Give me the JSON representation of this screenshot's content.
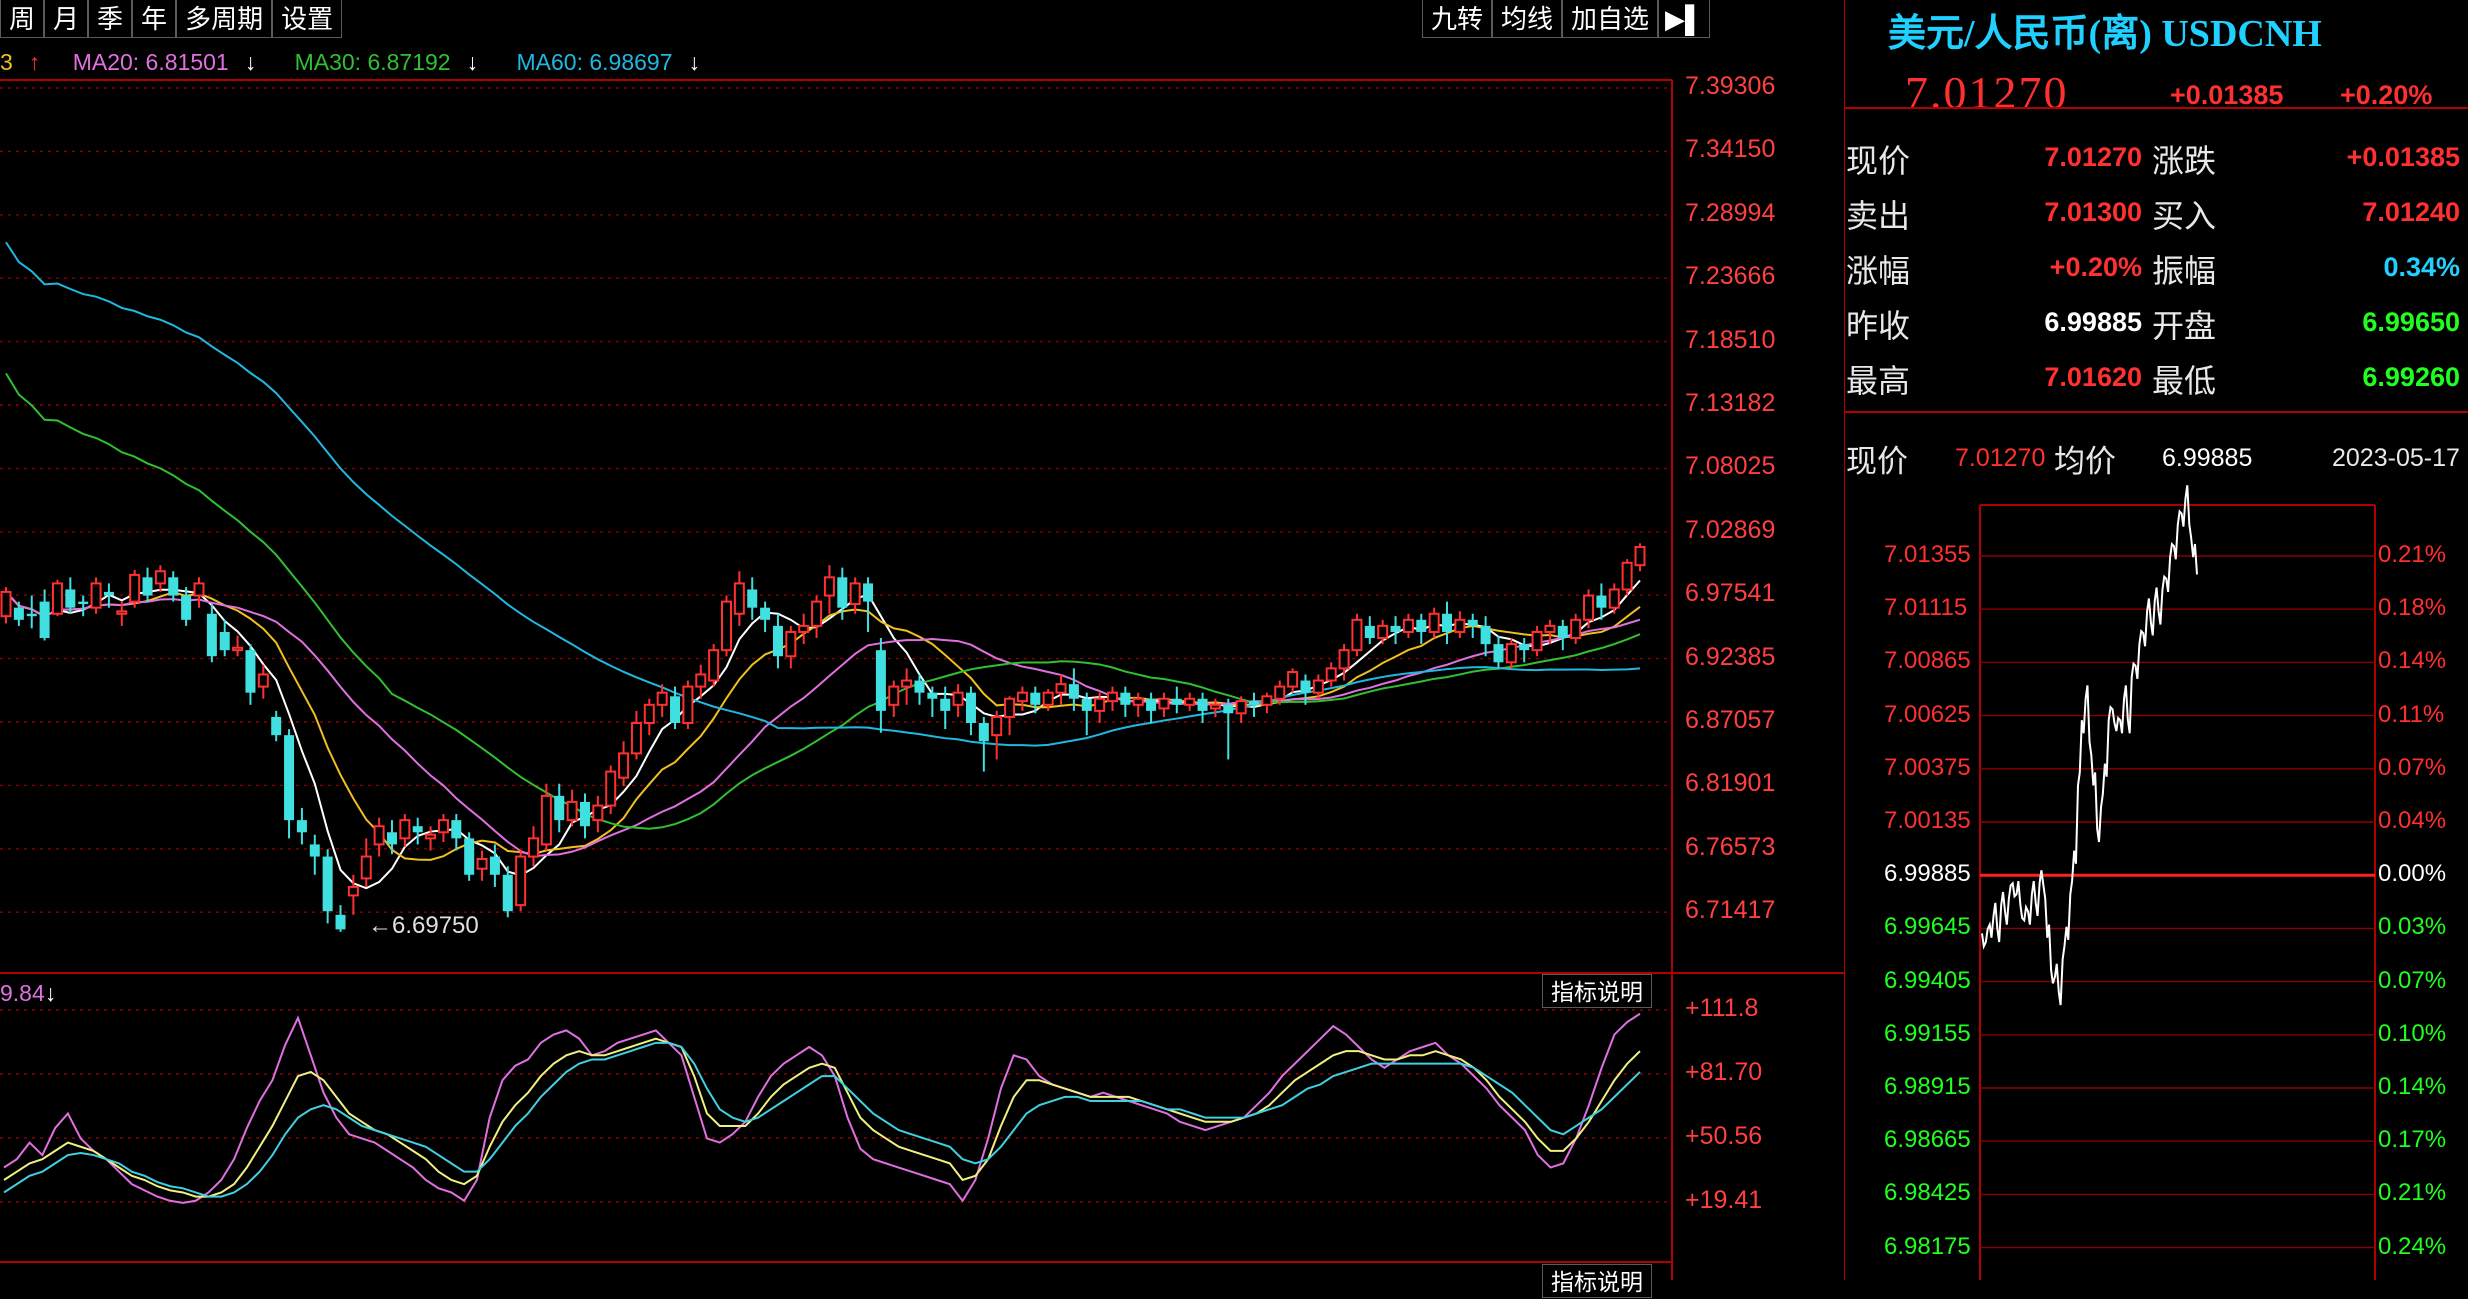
{
  "period_tabs": [
    "周",
    "月",
    "季",
    "年",
    "多周期",
    "设置"
  ],
  "right_tabs": [
    "九转",
    "均线",
    "加自选"
  ],
  "ma_legend": [
    {
      "prefix": "3",
      "arrow": "↑",
      "color": "#f0c020"
    },
    {
      "label": "MA20: 6.81501",
      "arrow": "↓",
      "color": "#e070e0"
    },
    {
      "label": "MA30: 6.87192",
      "arrow": "↓",
      "color": "#30c030"
    },
    {
      "label": "MA60: 6.98697",
      "arrow": "↓",
      "color": "#20b8e0"
    }
  ],
  "price_axis": [
    "7.39306",
    "7.34150",
    "7.28994",
    "7.23666",
    "7.18510",
    "7.13182",
    "7.08025",
    "7.02869",
    "6.97541",
    "6.92385",
    "6.87057",
    "6.81901",
    "6.76573",
    "6.71417"
  ],
  "low_marker": "←6.69750",
  "indicator": {
    "value_label": "9.84",
    "arrow": "↓",
    "button": "指标说明",
    "axis": [
      "+111.8",
      "+81.70",
      "+50.56",
      "+19.41"
    ],
    "bottom_button": "指标说明"
  },
  "quote": {
    "title": "美元/人民币(离) USDCNH",
    "price": "7.01270",
    "change": "+0.01385",
    "change_pct": "+0.20%",
    "rows": [
      {
        "l1": "现价",
        "v1": "7.01270",
        "c1": "#ff3030",
        "l2": "涨跌",
        "v2": "+0.01385",
        "c2": "#ff3030"
      },
      {
        "l1": "卖出",
        "v1": "7.01300",
        "c1": "#ff3030",
        "l2": "买入",
        "v2": "7.01240",
        "c2": "#ff3030"
      },
      {
        "l1": "涨幅",
        "v1": "+0.20%",
        "c1": "#ff3030",
        "l2": "振幅",
        "v2": "0.34%",
        "c2": "#20d0ff"
      },
      {
        "l1": "昨收",
        "v1": "6.99885",
        "c1": "#ffffff",
        "l2": "开盘",
        "v2": "6.99650",
        "c2": "#20ff20"
      },
      {
        "l1": "最高",
        "v1": "7.01620",
        "c1": "#ff3030",
        "l2": "最低",
        "v2": "6.99260",
        "c2": "#20ff20"
      }
    ]
  },
  "intraday": {
    "price_label": "现价",
    "price": "7.01270",
    "avg_label": "均价",
    "avg": "6.99885",
    "date": "2023-05-17",
    "left_axis": [
      "7.01355",
      "7.01115",
      "7.00865",
      "7.00625",
      "7.00375",
      "7.00135",
      "6.99885",
      "6.99645",
      "6.99405",
      "6.99155",
      "6.98915",
      "6.98665",
      "6.98425",
      "6.98175"
    ],
    "right_axis": [
      "0.21%",
      "0.18%",
      "0.14%",
      "0.11%",
      "0.07%",
      "0.04%",
      "0.00%",
      "0.03%",
      "0.07%",
      "0.10%",
      "0.14%",
      "0.17%",
      "0.21%",
      "0.24%"
    ]
  },
  "colors": {
    "up": "#ff3030",
    "down": "#40e0e0",
    "grid": "#8b0000",
    "frame": "#b00000"
  },
  "chart_data": {
    "type": "candlestick",
    "ylim": [
      6.69,
      7.4
    ],
    "candles": [
      [
        6.958,
        6.978,
        6.952,
        6.982
      ],
      [
        6.965,
        6.955,
        6.95,
        6.97
      ],
      [
        6.96,
        6.958,
        6.948,
        6.975
      ],
      [
        6.97,
        6.94,
        6.938,
        6.98
      ],
      [
        6.96,
        6.985,
        6.958,
        6.988
      ],
      [
        6.98,
        6.965,
        6.96,
        6.99
      ],
      [
        6.97,
        6.968,
        6.958,
        6.975
      ],
      [
        6.965,
        6.985,
        6.96,
        6.99
      ],
      [
        6.978,
        6.975,
        6.965,
        6.985
      ],
      [
        6.96,
        6.962,
        6.95,
        6.97
      ],
      [
        6.97,
        6.992,
        6.965,
        6.996
      ],
      [
        6.99,
        6.975,
        6.97,
        6.998
      ],
      [
        6.985,
        6.995,
        6.978,
        7.0
      ],
      [
        6.99,
        6.975,
        6.97,
        6.995
      ],
      [
        6.975,
        6.955,
        6.95,
        6.982
      ],
      [
        6.975,
        6.985,
        6.965,
        6.99
      ],
      [
        6.96,
        6.925,
        6.92,
        6.968
      ],
      [
        6.945,
        6.93,
        6.925,
        6.955
      ],
      [
        6.93,
        6.932,
        6.925,
        6.942
      ],
      [
        6.93,
        6.895,
        6.885,
        6.935
      ],
      [
        6.9,
        6.91,
        6.89,
        6.918
      ],
      [
        6.875,
        6.86,
        6.855,
        6.88
      ],
      [
        6.86,
        6.79,
        6.775,
        6.865
      ],
      [
        6.79,
        6.78,
        6.77,
        6.8
      ],
      [
        6.77,
        6.76,
        6.745,
        6.778
      ],
      [
        6.76,
        6.715,
        6.705,
        6.766
      ],
      [
        6.712,
        6.7,
        6.698,
        6.72
      ],
      [
        6.728,
        6.735,
        6.712,
        6.745
      ],
      [
        6.742,
        6.76,
        6.735,
        6.775
      ],
      [
        6.77,
        6.785,
        6.76,
        6.792
      ],
      [
        6.78,
        6.77,
        6.762,
        6.79
      ],
      [
        6.775,
        6.79,
        6.768,
        6.795
      ],
      [
        6.785,
        6.78,
        6.77,
        6.792
      ],
      [
        6.775,
        6.778,
        6.765,
        6.785
      ],
      [
        6.78,
        6.79,
        6.772,
        6.795
      ],
      [
        6.79,
        6.775,
        6.765,
        6.795
      ],
      [
        6.775,
        6.745,
        6.74,
        6.78
      ],
      [
        6.75,
        6.758,
        6.74,
        6.765
      ],
      [
        6.76,
        6.745,
        6.735,
        6.77
      ],
      [
        6.745,
        6.715,
        6.71,
        6.752
      ],
      [
        6.72,
        6.76,
        6.715,
        6.765
      ],
      [
        6.76,
        6.775,
        6.752,
        6.785
      ],
      [
        6.77,
        6.81,
        6.765,
        6.82
      ],
      [
        6.81,
        6.79,
        6.78,
        6.82
      ],
      [
        6.79,
        6.805,
        6.785,
        6.815
      ],
      [
        6.805,
        6.785,
        6.775,
        6.812
      ],
      [
        6.79,
        6.802,
        6.78,
        6.81
      ],
      [
        6.802,
        6.83,
        6.795,
        6.835
      ],
      [
        6.825,
        6.845,
        6.818,
        6.855
      ],
      [
        6.845,
        6.87,
        6.84,
        6.88
      ],
      [
        6.87,
        6.885,
        6.86,
        6.89
      ],
      [
        6.885,
        6.895,
        6.875,
        6.902
      ],
      [
        6.892,
        6.87,
        6.865,
        6.9
      ],
      [
        6.87,
        6.9,
        6.865,
        6.905
      ],
      [
        6.9,
        6.91,
        6.89,
        6.918
      ],
      [
        6.905,
        6.93,
        6.9,
        6.935
      ],
      [
        6.93,
        6.97,
        6.925,
        6.975
      ],
      [
        6.96,
        6.985,
        6.95,
        6.995
      ],
      [
        6.98,
        6.965,
        6.955,
        6.99
      ],
      [
        6.965,
        6.955,
        6.945,
        6.97
      ],
      [
        6.95,
        6.925,
        6.915,
        6.96
      ],
      [
        6.925,
        6.945,
        6.915,
        6.95
      ],
      [
        6.945,
        6.95,
        6.935,
        6.96
      ],
      [
        6.95,
        6.97,
        6.94,
        6.975
      ],
      [
        6.975,
        6.99,
        6.96,
        7.0
      ],
      [
        6.99,
        6.965,
        6.955,
        6.998
      ],
      [
        6.968,
        6.985,
        6.96,
        6.99
      ],
      [
        6.985,
        6.97,
        6.945,
        6.99
      ],
      [
        6.93,
        6.88,
        6.862,
        6.94
      ],
      [
        6.885,
        6.9,
        6.875,
        6.905
      ],
      [
        6.9,
        6.905,
        6.885,
        6.915
      ],
      [
        6.905,
        6.895,
        6.885,
        6.91
      ],
      [
        6.895,
        6.89,
        6.875,
        6.9
      ],
      [
        6.89,
        6.88,
        6.865,
        6.9
      ],
      [
        6.885,
        6.895,
        6.875,
        6.902
      ],
      [
        6.895,
        6.87,
        6.86,
        6.9
      ],
      [
        6.87,
        6.855,
        6.83,
        6.875
      ],
      [
        6.86,
        6.875,
        6.84,
        6.88
      ],
      [
        6.875,
        6.89,
        6.86,
        6.892
      ],
      [
        6.888,
        6.895,
        6.88,
        6.9
      ],
      [
        6.895,
        6.885,
        6.878,
        6.9
      ],
      [
        6.885,
        6.895,
        6.88,
        6.898
      ],
      [
        6.895,
        6.902,
        6.885,
        6.91
      ],
      [
        6.902,
        6.89,
        6.88,
        6.915
      ],
      [
        6.89,
        6.88,
        6.86,
        6.895
      ],
      [
        6.88,
        6.89,
        6.87,
        6.895
      ],
      [
        6.888,
        6.895,
        6.88,
        6.9
      ],
      [
        6.895,
        6.885,
        6.875,
        6.9
      ],
      [
        6.885,
        6.89,
        6.875,
        6.895
      ],
      [
        6.89,
        6.88,
        6.87,
        6.895
      ],
      [
        6.882,
        6.89,
        6.875,
        6.895
      ],
      [
        6.89,
        6.885,
        6.878,
        6.9
      ],
      [
        6.885,
        6.89,
        6.88,
        6.895
      ],
      [
        6.89,
        6.88,
        6.87,
        6.895
      ],
      [
        6.882,
        6.885,
        6.875,
        6.89
      ],
      [
        6.885,
        6.878,
        6.84,
        6.89
      ],
      [
        6.878,
        6.888,
        6.87,
        6.892
      ],
      [
        6.888,
        6.885,
        6.875,
        6.895
      ],
      [
        6.885,
        6.892,
        6.878,
        6.895
      ],
      [
        6.89,
        6.9,
        6.885,
        6.905
      ],
      [
        6.9,
        6.912,
        6.895,
        6.915
      ],
      [
        6.905,
        6.895,
        6.885,
        6.91
      ],
      [
        6.895,
        6.905,
        6.89,
        6.91
      ],
      [
        6.905,
        6.915,
        6.9,
        6.92
      ],
      [
        6.915,
        6.93,
        6.905,
        6.935
      ],
      [
        6.93,
        6.955,
        6.925,
        6.96
      ],
      [
        6.95,
        6.94,
        6.935,
        6.958
      ],
      [
        6.94,
        6.95,
        6.935,
        6.955
      ],
      [
        6.95,
        6.945,
        6.935,
        6.958
      ],
      [
        6.945,
        6.955,
        6.94,
        6.96
      ],
      [
        6.955,
        6.945,
        6.935,
        6.96
      ],
      [
        6.945,
        6.96,
        6.94,
        6.965
      ],
      [
        6.96,
        6.945,
        6.935,
        6.97
      ],
      [
        6.945,
        6.955,
        6.94,
        6.962
      ],
      [
        6.955,
        6.95,
        6.94,
        6.96
      ],
      [
        6.95,
        6.935,
        6.925,
        6.958
      ],
      [
        6.935,
        6.92,
        6.915,
        6.942
      ],
      [
        6.92,
        6.935,
        6.915,
        6.94
      ],
      [
        6.935,
        6.93,
        6.92,
        6.94
      ],
      [
        6.93,
        6.945,
        6.925,
        6.95
      ],
      [
        6.945,
        6.95,
        6.935,
        6.955
      ],
      [
        6.95,
        6.94,
        6.93,
        6.955
      ],
      [
        6.94,
        6.955,
        6.935,
        6.96
      ],
      [
        6.955,
        6.975,
        6.948,
        6.98
      ],
      [
        6.975,
        6.965,
        6.955,
        6.985
      ],
      [
        6.965,
        6.98,
        6.96,
        6.985
      ],
      [
        6.98,
        7.002,
        6.975,
        7.005
      ],
      [
        7.0,
        7.015,
        6.995,
        7.018
      ]
    ],
    "oscillator": [
      [
        36,
        30,
        24
      ],
      [
        40,
        34,
        28
      ],
      [
        48,
        38,
        32
      ],
      [
        42,
        40,
        34
      ],
      [
        55,
        44,
        38
      ],
      [
        62,
        48,
        42
      ],
      [
        50,
        46,
        43
      ],
      [
        44,
        44,
        42
      ],
      [
        40,
        40,
        40
      ],
      [
        34,
        36,
        38
      ],
      [
        28,
        32,
        34
      ],
      [
        25,
        30,
        32
      ],
      [
        22,
        27,
        29
      ],
      [
        20,
        25,
        27
      ],
      [
        19,
        24,
        26
      ],
      [
        20,
        22,
        24
      ],
      [
        24,
        22,
        22
      ],
      [
        30,
        24,
        22
      ],
      [
        40,
        28,
        24
      ],
      [
        55,
        36,
        28
      ],
      [
        68,
        46,
        34
      ],
      [
        78,
        56,
        42
      ],
      [
        95,
        68,
        52
      ],
      [
        108,
        80,
        60
      ],
      [
        90,
        82,
        64
      ],
      [
        72,
        78,
        66
      ],
      [
        60,
        70,
        64
      ],
      [
        52,
        62,
        60
      ],
      [
        50,
        58,
        56
      ],
      [
        48,
        54,
        54
      ],
      [
        44,
        52,
        52
      ],
      [
        40,
        48,
        50
      ],
      [
        36,
        44,
        48
      ],
      [
        30,
        40,
        46
      ],
      [
        26,
        34,
        42
      ],
      [
        24,
        30,
        38
      ],
      [
        20,
        28,
        34
      ],
      [
        30,
        32,
        34
      ],
      [
        60,
        46,
        40
      ],
      [
        78,
        58,
        48
      ],
      [
        85,
        66,
        56
      ],
      [
        88,
        72,
        62
      ],
      [
        96,
        80,
        70
      ],
      [
        100,
        86,
        76
      ],
      [
        102,
        90,
        82
      ],
      [
        98,
        92,
        86
      ],
      [
        90,
        90,
        88
      ],
      [
        92,
        90,
        88
      ],
      [
        96,
        92,
        90
      ],
      [
        98,
        94,
        92
      ],
      [
        100,
        96,
        94
      ],
      [
        102,
        98,
        96
      ],
      [
        96,
        96,
        96
      ],
      [
        90,
        94,
        94
      ],
      [
        70,
        80,
        86
      ],
      [
        50,
        62,
        74
      ],
      [
        48,
        56,
        64
      ],
      [
        52,
        56,
        60
      ],
      [
        58,
        56,
        58
      ],
      [
        70,
        62,
        60
      ],
      [
        80,
        70,
        64
      ],
      [
        86,
        76,
        68
      ],
      [
        90,
        80,
        72
      ],
      [
        94,
        84,
        76
      ],
      [
        90,
        86,
        80
      ],
      [
        80,
        84,
        80
      ],
      [
        60,
        72,
        74
      ],
      [
        45,
        60,
        68
      ],
      [
        40,
        54,
        62
      ],
      [
        38,
        50,
        58
      ],
      [
        36,
        46,
        54
      ],
      [
        34,
        44,
        52
      ],
      [
        32,
        42,
        50
      ],
      [
        30,
        40,
        48
      ],
      [
        28,
        38,
        46
      ],
      [
        20,
        30,
        40
      ],
      [
        30,
        32,
        38
      ],
      [
        50,
        40,
        40
      ],
      [
        74,
        56,
        46
      ],
      [
        90,
        70,
        54
      ],
      [
        88,
        78,
        62
      ],
      [
        80,
        78,
        66
      ],
      [
        76,
        76,
        68
      ],
      [
        74,
        74,
        70
      ],
      [
        72,
        72,
        70
      ],
      [
        70,
        70,
        68
      ],
      [
        72,
        70,
        68
      ],
      [
        70,
        70,
        68
      ],
      [
        68,
        70,
        68
      ],
      [
        66,
        68,
        68
      ],
      [
        64,
        66,
        66
      ],
      [
        62,
        64,
        64
      ],
      [
        58,
        62,
        64
      ],
      [
        56,
        60,
        62
      ],
      [
        54,
        58,
        60
      ],
      [
        56,
        58,
        60
      ],
      [
        58,
        58,
        60
      ],
      [
        60,
        60,
        60
      ],
      [
        66,
        62,
        62
      ],
      [
        72,
        66,
        64
      ],
      [
        80,
        72,
        66
      ],
      [
        86,
        78,
        70
      ],
      [
        92,
        82,
        74
      ],
      [
        98,
        86,
        76
      ],
      [
        104,
        90,
        80
      ],
      [
        100,
        92,
        82
      ],
      [
        94,
        92,
        84
      ],
      [
        88,
        90,
        86
      ],
      [
        84,
        88,
        86
      ],
      [
        88,
        88,
        86
      ],
      [
        92,
        90,
        86
      ],
      [
        94,
        90,
        86
      ],
      [
        96,
        92,
        86
      ],
      [
        90,
        90,
        86
      ],
      [
        86,
        88,
        86
      ],
      [
        80,
        84,
        84
      ],
      [
        74,
        78,
        80
      ],
      [
        66,
        70,
        76
      ],
      [
        60,
        64,
        72
      ],
      [
        54,
        58,
        66
      ],
      [
        42,
        50,
        60
      ],
      [
        36,
        44,
        54
      ],
      [
        38,
        44,
        52
      ],
      [
        50,
        50,
        56
      ],
      [
        66,
        58,
        60
      ],
      [
        84,
        68,
        64
      ],
      [
        100,
        78,
        70
      ],
      [
        106,
        86,
        76
      ],
      [
        110,
        92,
        82
      ]
    ],
    "intraday_series": [
      6.9962,
      6.9958,
      6.9966,
      6.997,
      6.9964,
      6.9975,
      6.9972,
      6.9978,
      6.9985,
      6.998,
      6.9975,
      6.9968,
      6.9972,
      6.998,
      6.9976,
      6.9985,
      6.9984,
      6.996,
      6.9945,
      6.9942,
      6.9935,
      6.995,
      6.9965,
      6.998,
      7.0,
      7.003,
      7.006,
      7.007,
      7.005,
      7.003,
      7.001,
      7.002,
      7.004,
      7.006,
      7.0065,
      7.0055,
      7.006,
      7.007,
      7.006,
      7.008,
      7.0085,
      7.0095,
      7.01,
      7.011,
      7.0105,
      7.0115,
      7.011,
      7.012,
      7.0125,
      7.0135,
      7.014,
      7.015,
      7.0155,
      7.0162,
      7.015,
      7.0135,
      7.0127
    ]
  }
}
